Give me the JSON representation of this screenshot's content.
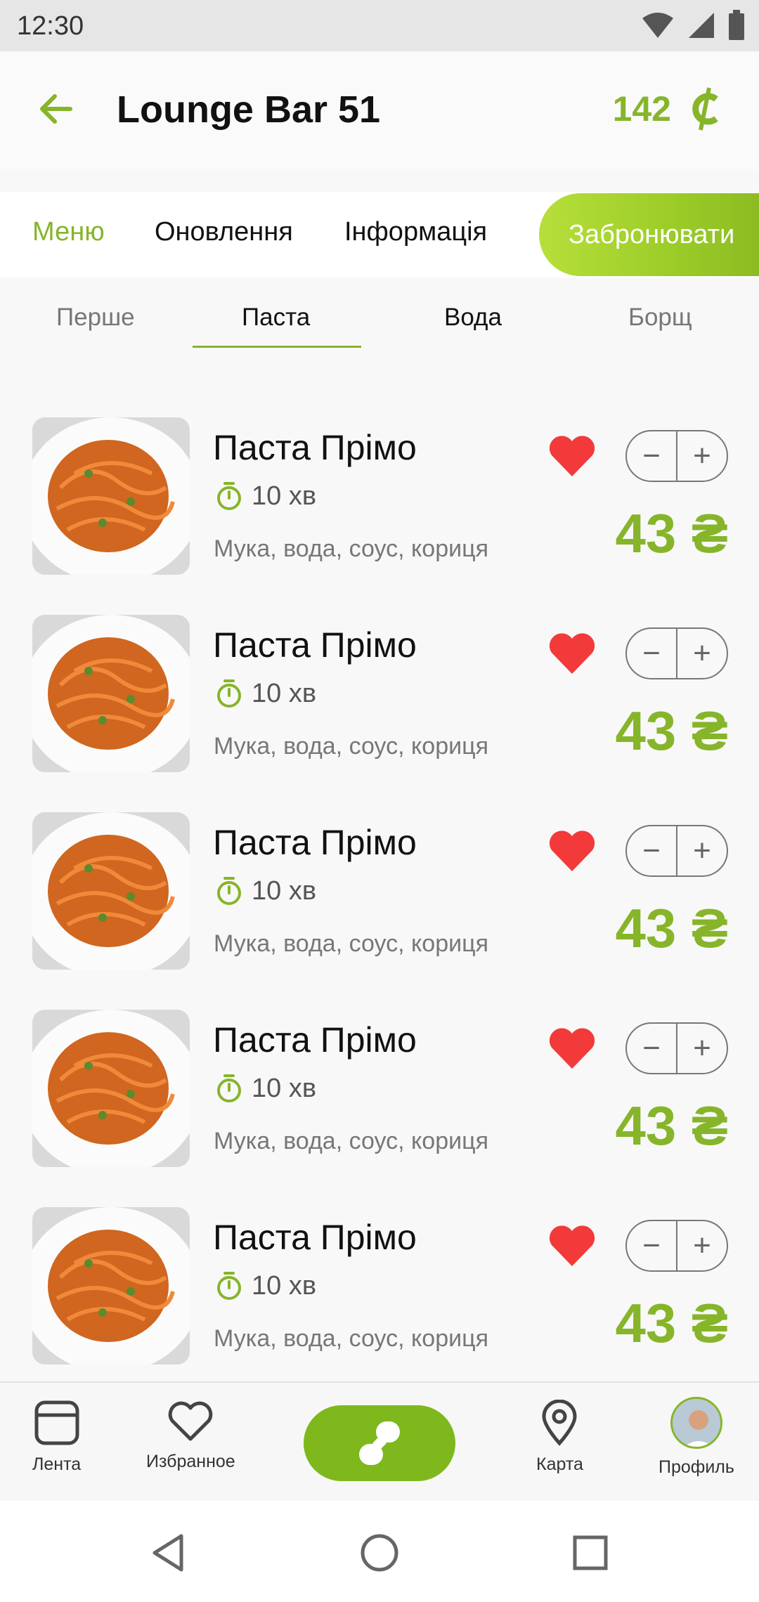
{
  "status": {
    "time": "12:30"
  },
  "header": {
    "title": "Lounge Bar 51",
    "coins": "142"
  },
  "tabs": [
    {
      "label": "Меню"
    },
    {
      "label": "Оновлення"
    },
    {
      "label": "Інформація"
    }
  ],
  "book_button": "Забронювати",
  "subcategories": [
    {
      "label": "Перше"
    },
    {
      "label": "Паста"
    },
    {
      "label": "Вода"
    },
    {
      "label": "Борщ"
    }
  ],
  "items": [
    {
      "name": "Паста Прімо",
      "time": "10 хв",
      "desc": "Мука, вода, соус, кориця",
      "price": "43 ₴"
    },
    {
      "name": "Паста Прімо",
      "time": "10 хв",
      "desc": "Мука, вода, соус, кориця",
      "price": "43 ₴"
    },
    {
      "name": "Паста Прімо",
      "time": "10 хв",
      "desc": "Мука, вода, соус, кориця",
      "price": "43 ₴"
    },
    {
      "name": "Паста Прімо",
      "time": "10 хв",
      "desc": "Мука, вода, соус, кориця",
      "price": "43 ₴"
    },
    {
      "name": "Паста Прімо",
      "time": "10 хв",
      "desc": "Мука, вода, соус, кориця",
      "price": "43 ₴"
    }
  ],
  "bottom_nav": {
    "feed": "Лента",
    "favorites": "Избранное",
    "map": "Карта",
    "profile": "Профиль"
  },
  "colors": {
    "accent": "#86b52a",
    "heart": "#f23a3a"
  }
}
